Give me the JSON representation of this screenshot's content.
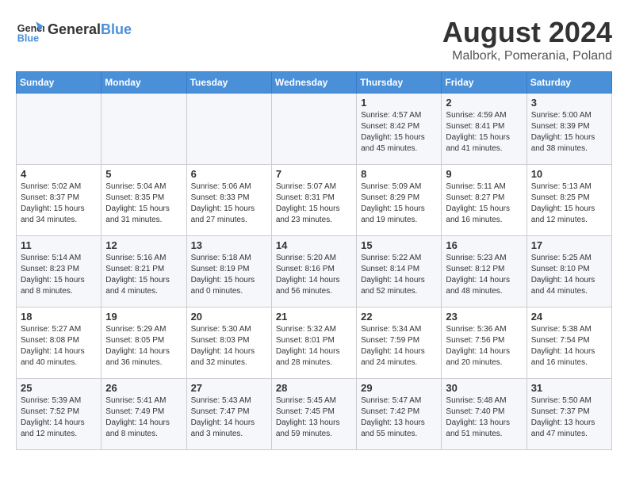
{
  "header": {
    "logo_text_general": "General",
    "logo_text_blue": "Blue",
    "month_year": "August 2024",
    "location": "Malbork, Pomerania, Poland"
  },
  "weekdays": [
    "Sunday",
    "Monday",
    "Tuesday",
    "Wednesday",
    "Thursday",
    "Friday",
    "Saturday"
  ],
  "weeks": [
    [
      {
        "day": "",
        "info": ""
      },
      {
        "day": "",
        "info": ""
      },
      {
        "day": "",
        "info": ""
      },
      {
        "day": "",
        "info": ""
      },
      {
        "day": "1",
        "info": "Sunrise: 4:57 AM\nSunset: 8:42 PM\nDaylight: 15 hours\nand 45 minutes."
      },
      {
        "day": "2",
        "info": "Sunrise: 4:59 AM\nSunset: 8:41 PM\nDaylight: 15 hours\nand 41 minutes."
      },
      {
        "day": "3",
        "info": "Sunrise: 5:00 AM\nSunset: 8:39 PM\nDaylight: 15 hours\nand 38 minutes."
      }
    ],
    [
      {
        "day": "4",
        "info": "Sunrise: 5:02 AM\nSunset: 8:37 PM\nDaylight: 15 hours\nand 34 minutes."
      },
      {
        "day": "5",
        "info": "Sunrise: 5:04 AM\nSunset: 8:35 PM\nDaylight: 15 hours\nand 31 minutes."
      },
      {
        "day": "6",
        "info": "Sunrise: 5:06 AM\nSunset: 8:33 PM\nDaylight: 15 hours\nand 27 minutes."
      },
      {
        "day": "7",
        "info": "Sunrise: 5:07 AM\nSunset: 8:31 PM\nDaylight: 15 hours\nand 23 minutes."
      },
      {
        "day": "8",
        "info": "Sunrise: 5:09 AM\nSunset: 8:29 PM\nDaylight: 15 hours\nand 19 minutes."
      },
      {
        "day": "9",
        "info": "Sunrise: 5:11 AM\nSunset: 8:27 PM\nDaylight: 15 hours\nand 16 minutes."
      },
      {
        "day": "10",
        "info": "Sunrise: 5:13 AM\nSunset: 8:25 PM\nDaylight: 15 hours\nand 12 minutes."
      }
    ],
    [
      {
        "day": "11",
        "info": "Sunrise: 5:14 AM\nSunset: 8:23 PM\nDaylight: 15 hours\nand 8 minutes."
      },
      {
        "day": "12",
        "info": "Sunrise: 5:16 AM\nSunset: 8:21 PM\nDaylight: 15 hours\nand 4 minutes."
      },
      {
        "day": "13",
        "info": "Sunrise: 5:18 AM\nSunset: 8:19 PM\nDaylight: 15 hours\nand 0 minutes."
      },
      {
        "day": "14",
        "info": "Sunrise: 5:20 AM\nSunset: 8:16 PM\nDaylight: 14 hours\nand 56 minutes."
      },
      {
        "day": "15",
        "info": "Sunrise: 5:22 AM\nSunset: 8:14 PM\nDaylight: 14 hours\nand 52 minutes."
      },
      {
        "day": "16",
        "info": "Sunrise: 5:23 AM\nSunset: 8:12 PM\nDaylight: 14 hours\nand 48 minutes."
      },
      {
        "day": "17",
        "info": "Sunrise: 5:25 AM\nSunset: 8:10 PM\nDaylight: 14 hours\nand 44 minutes."
      }
    ],
    [
      {
        "day": "18",
        "info": "Sunrise: 5:27 AM\nSunset: 8:08 PM\nDaylight: 14 hours\nand 40 minutes."
      },
      {
        "day": "19",
        "info": "Sunrise: 5:29 AM\nSunset: 8:05 PM\nDaylight: 14 hours\nand 36 minutes."
      },
      {
        "day": "20",
        "info": "Sunrise: 5:30 AM\nSunset: 8:03 PM\nDaylight: 14 hours\nand 32 minutes."
      },
      {
        "day": "21",
        "info": "Sunrise: 5:32 AM\nSunset: 8:01 PM\nDaylight: 14 hours\nand 28 minutes."
      },
      {
        "day": "22",
        "info": "Sunrise: 5:34 AM\nSunset: 7:59 PM\nDaylight: 14 hours\nand 24 minutes."
      },
      {
        "day": "23",
        "info": "Sunrise: 5:36 AM\nSunset: 7:56 PM\nDaylight: 14 hours\nand 20 minutes."
      },
      {
        "day": "24",
        "info": "Sunrise: 5:38 AM\nSunset: 7:54 PM\nDaylight: 14 hours\nand 16 minutes."
      }
    ],
    [
      {
        "day": "25",
        "info": "Sunrise: 5:39 AM\nSunset: 7:52 PM\nDaylight: 14 hours\nand 12 minutes."
      },
      {
        "day": "26",
        "info": "Sunrise: 5:41 AM\nSunset: 7:49 PM\nDaylight: 14 hours\nand 8 minutes."
      },
      {
        "day": "27",
        "info": "Sunrise: 5:43 AM\nSunset: 7:47 PM\nDaylight: 14 hours\nand 3 minutes."
      },
      {
        "day": "28",
        "info": "Sunrise: 5:45 AM\nSunset: 7:45 PM\nDaylight: 13 hours\nand 59 minutes."
      },
      {
        "day": "29",
        "info": "Sunrise: 5:47 AM\nSunset: 7:42 PM\nDaylight: 13 hours\nand 55 minutes."
      },
      {
        "day": "30",
        "info": "Sunrise: 5:48 AM\nSunset: 7:40 PM\nDaylight: 13 hours\nand 51 minutes."
      },
      {
        "day": "31",
        "info": "Sunrise: 5:50 AM\nSunset: 7:37 PM\nDaylight: 13 hours\nand 47 minutes."
      }
    ]
  ]
}
